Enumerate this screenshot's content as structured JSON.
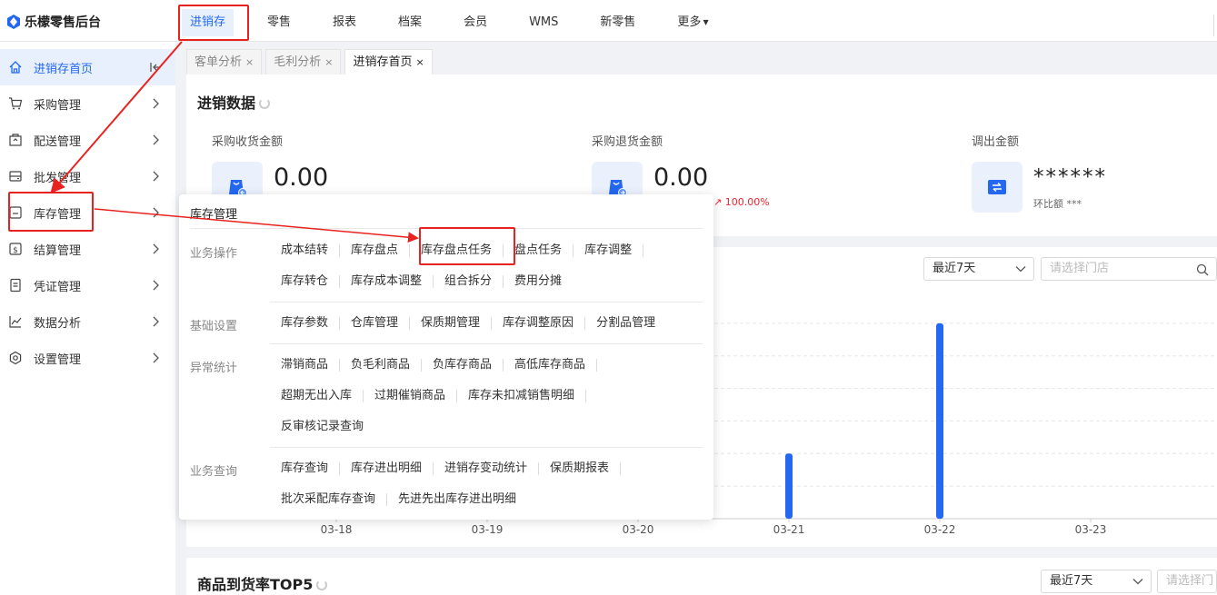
{
  "app": {
    "title": "乐檬零售后台"
  },
  "topnav": [
    {
      "label": "进销存",
      "active": true
    },
    {
      "label": "零售"
    },
    {
      "label": "报表"
    },
    {
      "label": "档案"
    },
    {
      "label": "会员"
    },
    {
      "label": "WMS"
    },
    {
      "label": "新零售"
    },
    {
      "label": "更多",
      "has_caret": true
    }
  ],
  "sidebar": {
    "items": [
      {
        "label": "进销存首页",
        "icon": "home-icon",
        "active": true
      },
      {
        "label": "采购管理",
        "icon": "cart-icon"
      },
      {
        "label": "配送管理",
        "icon": "delivery-icon"
      },
      {
        "label": "批发管理",
        "icon": "wholesale-icon"
      },
      {
        "label": "库存管理",
        "icon": "inventory-icon"
      },
      {
        "label": "结算管理",
        "icon": "settlement-icon"
      },
      {
        "label": "凭证管理",
        "icon": "voucher-icon"
      },
      {
        "label": "数据分析",
        "icon": "analytics-icon"
      },
      {
        "label": "设置管理",
        "icon": "settings-icon"
      }
    ]
  },
  "tabs": [
    {
      "label": "客单分析",
      "close": "×"
    },
    {
      "label": "毛利分析",
      "close": "×"
    },
    {
      "label": "进销存首页",
      "close": "×",
      "active": true
    }
  ],
  "data_card": {
    "title": "进销数据",
    "metrics": [
      {
        "label": "采购收货金额",
        "value": "0.00",
        "icon": "purchase-receive-icon"
      },
      {
        "label": "采购退货金额",
        "value": "0.00",
        "icon": "purchase-return-icon",
        "trend": "100.00%"
      },
      {
        "label": "调出金额",
        "value": "******",
        "icon": "transfer-out-icon",
        "sub_label": "环比额",
        "sub_value": "***"
      }
    ]
  },
  "chart_filters": {
    "period": "最近7天",
    "store_placeholder": "请选择门店"
  },
  "chart_data": {
    "type": "bar",
    "categories": [
      "03-18",
      "03-19",
      "03-20",
      "03-21",
      "03-22",
      "03-23"
    ],
    "values": [
      0,
      0,
      0,
      1,
      3,
      0
    ],
    "ylim": [
      0,
      3.5
    ],
    "color": "#2468f2"
  },
  "bottom_card": {
    "title": "商品到货率TOP5",
    "period": "最近7天",
    "store_placeholder": "请选择门"
  },
  "dropdown": {
    "header": "库存管理",
    "sections": [
      {
        "category": "业务操作",
        "rows": [
          [
            "成本结转",
            "库存盘点",
            "库存盘点任务",
            "盘点任务",
            "库存调整"
          ],
          [
            "库存转仓",
            "库存成本调整",
            "组合拆分",
            "费用分摊"
          ]
        ]
      },
      {
        "category": "基础设置",
        "rows": [
          [
            "库存参数",
            "仓库管理",
            "保质期管理",
            "库存调整原因",
            "分割品管理"
          ]
        ]
      },
      {
        "category": "异常统计",
        "rows": [
          [
            "滞销商品",
            "负毛利商品",
            "负库存商品",
            "高低库存商品"
          ],
          [
            "超期无出入库",
            "过期催销商品",
            "库存未扣减销售明细"
          ],
          [
            "反审核记录查询"
          ]
        ]
      },
      {
        "category": "业务查询",
        "rows": [
          [
            "库存查询",
            "库存进出明细",
            "进销存变动统计",
            "保质期报表"
          ],
          [
            "批次采配库存查询",
            "先进先出库存进出明细"
          ]
        ]
      }
    ]
  },
  "annotations": {
    "color": "#e8231f"
  }
}
